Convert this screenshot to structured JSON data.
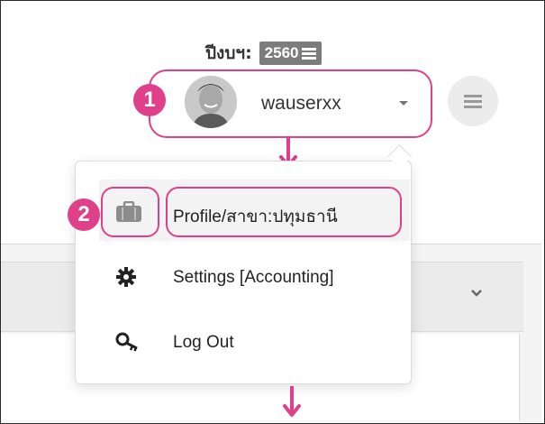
{
  "header": {
    "fiscal_year_label": "ปีงบฯ:",
    "fiscal_year_value": "2560",
    "username": "wauserxx"
  },
  "steps": {
    "step1": "1",
    "step2": "2"
  },
  "menu": {
    "items": [
      {
        "label": "Profile/สาขา:ปทุมธานี",
        "icon": "briefcase-icon"
      },
      {
        "label": "Settings [Accounting]",
        "icon": "gear-icon"
      },
      {
        "label": "Log Out",
        "icon": "key-icon"
      }
    ]
  },
  "colors": {
    "annotation": "#e0408a",
    "badge_bg": "#7c7c7c"
  }
}
